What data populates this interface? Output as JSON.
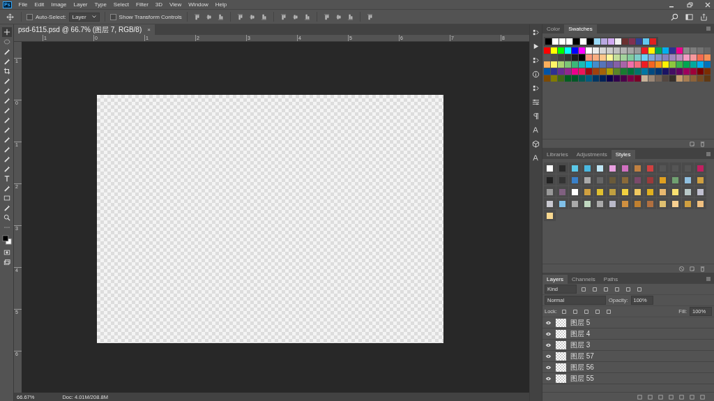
{
  "app_logo": "Ps",
  "menu": [
    "File",
    "Edit",
    "Image",
    "Layer",
    "Type",
    "Select",
    "Filter",
    "3D",
    "View",
    "Window",
    "Help"
  ],
  "options_bar": {
    "auto_select": {
      "label": "Auto-Select:",
      "checked": false
    },
    "target_dropdown": "Layer",
    "show_transform": {
      "label": "Show Transform Controls",
      "checked": false
    }
  },
  "document_tab": {
    "title": "psd-6115.psd @ 66.7% (图层 7, RGB/8)",
    "close": "×"
  },
  "top_ruler": [
    "1",
    "0",
    "1",
    "2",
    "3",
    "4",
    "5",
    "6",
    "7",
    "8"
  ],
  "left_ruler": [
    "1",
    "0",
    "1",
    "2",
    "3",
    "4",
    "5",
    "6"
  ],
  "status_bar": {
    "zoom": "66.67%",
    "doc_size": "Doc: 4.01M/208.8M"
  },
  "swatches_panel": {
    "tabs": [
      {
        "label": "Color",
        "selected": false
      },
      {
        "label": "Swatches",
        "selected": true
      }
    ],
    "recent": [
      {
        "color": "#000000"
      },
      {
        "color": "#ffffff"
      },
      {
        "color": "#ffffff"
      },
      {
        "color": "#ffffff"
      },
      {
        "color": "#000000"
      },
      {
        "color": "#ffffff"
      },
      {
        "color": "#000000"
      },
      {
        "color": "#99d9f7"
      },
      {
        "color": "#b8a8e0"
      },
      {
        "color": "#d0a8f0"
      },
      {
        "color": "#f0f0f0"
      },
      {
        "color": "#6a3030"
      },
      {
        "color": "#803050"
      },
      {
        "color": "#304090"
      },
      {
        "color": "#60c8f0"
      },
      {
        "color": "#e02020"
      }
    ],
    "swatches": [
      {
        "color": "#ff0000"
      },
      {
        "color": "#ffff00"
      },
      {
        "color": "#00ff00"
      },
      {
        "color": "#00ffff"
      },
      {
        "color": "#0000ff"
      },
      {
        "color": "#ff00ff"
      },
      {
        "color": "#ffffff"
      },
      {
        "color": "#ebebeb"
      },
      {
        "color": "#d6d6d6"
      },
      {
        "color": "#cccccc"
      },
      {
        "color": "#c0c0c0"
      },
      {
        "color": "#b3b3b3"
      },
      {
        "color": "#a6a6a6"
      },
      {
        "color": "#999999"
      },
      {
        "color": "#ed1c24"
      },
      {
        "color": "#fff200"
      },
      {
        "color": "#00a651"
      },
      {
        "color": "#00aeef"
      },
      {
        "color": "#2e3192"
      },
      {
        "color": "#ec008c"
      },
      {
        "color": "#898989"
      },
      {
        "color": "#7d7d7d"
      },
      {
        "color": "#737373"
      },
      {
        "color": "#666666"
      },
      {
        "color": "#595959"
      },
      {
        "color": "#4d4d4d"
      },
      {
        "color": "#404040"
      },
      {
        "color": "#333333"
      },
      {
        "color": "#1a1a1a"
      },
      {
        "color": "#000000"
      },
      {
        "color": "#f7977a"
      },
      {
        "color": "#f9ad81"
      },
      {
        "color": "#fdc68a"
      },
      {
        "color": "#fff79a"
      },
      {
        "color": "#c4df9b"
      },
      {
        "color": "#a3d39c"
      },
      {
        "color": "#82ca9d"
      },
      {
        "color": "#7bcdc8"
      },
      {
        "color": "#6dcff6"
      },
      {
        "color": "#7da7d9"
      },
      {
        "color": "#8393ca"
      },
      {
        "color": "#8781bd"
      },
      {
        "color": "#a187be"
      },
      {
        "color": "#bd8cbf"
      },
      {
        "color": "#f49ac2"
      },
      {
        "color": "#f6989d"
      },
      {
        "color": "#f26c4f"
      },
      {
        "color": "#f68e55"
      },
      {
        "color": "#fbaf5c"
      },
      {
        "color": "#fff467"
      },
      {
        "color": "#acd372"
      },
      {
        "color": "#7cc576"
      },
      {
        "color": "#3bb878"
      },
      {
        "color": "#1abbb4"
      },
      {
        "color": "#00bff3"
      },
      {
        "color": "#448ccb"
      },
      {
        "color": "#5674b9"
      },
      {
        "color": "#605ca8"
      },
      {
        "color": "#8560a8"
      },
      {
        "color": "#a864a8"
      },
      {
        "color": "#f06eaa"
      },
      {
        "color": "#f26d7d"
      },
      {
        "color": "#ed1c24"
      },
      {
        "color": "#f26522"
      },
      {
        "color": "#f7941d"
      },
      {
        "color": "#fff200"
      },
      {
        "color": "#8dc73f"
      },
      {
        "color": "#39b54a"
      },
      {
        "color": "#00a651"
      },
      {
        "color": "#00a99d"
      },
      {
        "color": "#00aeef"
      },
      {
        "color": "#0072bc"
      },
      {
        "color": "#0054a6"
      },
      {
        "color": "#2e3192"
      },
      {
        "color": "#662d91"
      },
      {
        "color": "#92278f"
      },
      {
        "color": "#ec008c"
      },
      {
        "color": "#ed145b"
      },
      {
        "color": "#9e0b0f"
      },
      {
        "color": "#a0410d"
      },
      {
        "color": "#a3620a"
      },
      {
        "color": "#aba000"
      },
      {
        "color": "#598527"
      },
      {
        "color": "#197b30"
      },
      {
        "color": "#007236"
      },
      {
        "color": "#00746b"
      },
      {
        "color": "#0076a3"
      },
      {
        "color": "#004a80"
      },
      {
        "color": "#003471"
      },
      {
        "color": "#1b1464"
      },
      {
        "color": "#440e62"
      },
      {
        "color": "#630460"
      },
      {
        "color": "#9e005d"
      },
      {
        "color": "#9e0039"
      },
      {
        "color": "#790000"
      },
      {
        "color": "#7b2e00"
      },
      {
        "color": "#7d4900"
      },
      {
        "color": "#827b00"
      },
      {
        "color": "#406618"
      },
      {
        "color": "#005e20"
      },
      {
        "color": "#005826"
      },
      {
        "color": "#005952"
      },
      {
        "color": "#005b7f"
      },
      {
        "color": "#003663"
      },
      {
        "color": "#002157"
      },
      {
        "color": "#0d004c"
      },
      {
        "color": "#32004b"
      },
      {
        "color": "#4b0049"
      },
      {
        "color": "#7b0046"
      },
      {
        "color": "#7a0026"
      },
      {
        "color": "#c7b299"
      },
      {
        "color": "#998675"
      },
      {
        "color": "#736357"
      },
      {
        "color": "#534741"
      },
      {
        "color": "#37302a"
      },
      {
        "color": "#c69c6d"
      },
      {
        "color": "#a67c52"
      },
      {
        "color": "#8c6239"
      },
      {
        "color": "#754c24"
      },
      {
        "color": "#603913"
      }
    ]
  },
  "styles_panel": {
    "tabs": [
      {
        "label": "Libraries",
        "selected": false
      },
      {
        "label": "Adjustments",
        "selected": false
      },
      {
        "label": "Styles",
        "selected": true
      }
    ]
  },
  "layers_panel": {
    "tabs": [
      {
        "label": "Layers",
        "selected": true
      },
      {
        "label": "Channels",
        "selected": false
      },
      {
        "label": "Paths",
        "selected": false
      }
    ],
    "filter": "Kind",
    "blend_mode": "Normal",
    "opacity_label": "Opacity:",
    "opacity": "100%",
    "lock_label": "Lock:",
    "fill_label": "Fill:",
    "fill": "100%",
    "layers": [
      {
        "name": "图层 5",
        "visible": true
      },
      {
        "name": "图层 4",
        "visible": true
      },
      {
        "name": "图层 3",
        "visible": true
      },
      {
        "name": "图层 57",
        "visible": true
      },
      {
        "name": "图层 56",
        "visible": true
      },
      {
        "name": "图层 55",
        "visible": true
      }
    ]
  }
}
